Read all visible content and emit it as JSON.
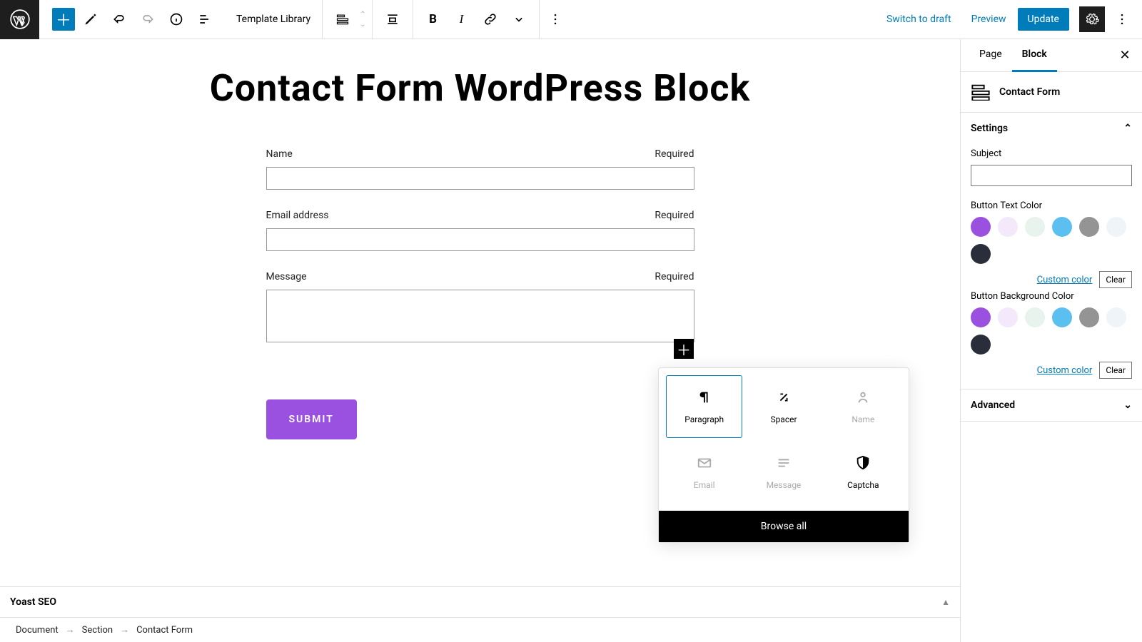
{
  "toolbar": {
    "template_library": "Template Library",
    "switch_draft": "Switch to draft",
    "preview": "Preview",
    "update": "Update"
  },
  "page": {
    "title": "Contact Form WordPress Block"
  },
  "form": {
    "fields": [
      {
        "label": "Name",
        "required": "Required",
        "type": "input"
      },
      {
        "label": "Email address",
        "required": "Required",
        "type": "input"
      },
      {
        "label": "Message",
        "required": "Required",
        "type": "textarea"
      }
    ],
    "submit": "SUBMIT"
  },
  "inserter": {
    "items": [
      {
        "label": "Paragraph",
        "icon": "paragraph",
        "state": "active"
      },
      {
        "label": "Spacer",
        "icon": "spacer",
        "state": "normal"
      },
      {
        "label": "Name",
        "icon": "name",
        "state": "disabled"
      },
      {
        "label": "Email",
        "icon": "email",
        "state": "disabled"
      },
      {
        "label": "Message",
        "icon": "message",
        "state": "disabled"
      },
      {
        "label": "Captcha",
        "icon": "captcha",
        "state": "normal"
      }
    ],
    "browse": "Browse all"
  },
  "sidebar": {
    "tabs": {
      "page": "Page",
      "block": "Block"
    },
    "block_name": "Contact Form",
    "settings_label": "Settings",
    "subject_label": "Subject",
    "btn_text_color_label": "Button Text Color",
    "btn_bg_color_label": "Button Background Color",
    "custom_color": "Custom color",
    "clear": "Clear",
    "advanced_label": "Advanced",
    "swatches": [
      "#9b51e0",
      "#f4e9fb",
      "#e8f3ed",
      "#5bc0f0",
      "#949494",
      "#eef4f7",
      "#2a2e3a"
    ]
  },
  "yoast": {
    "title": "Yoast SEO"
  },
  "breadcrumb": [
    "Document",
    "Section",
    "Contact Form"
  ]
}
